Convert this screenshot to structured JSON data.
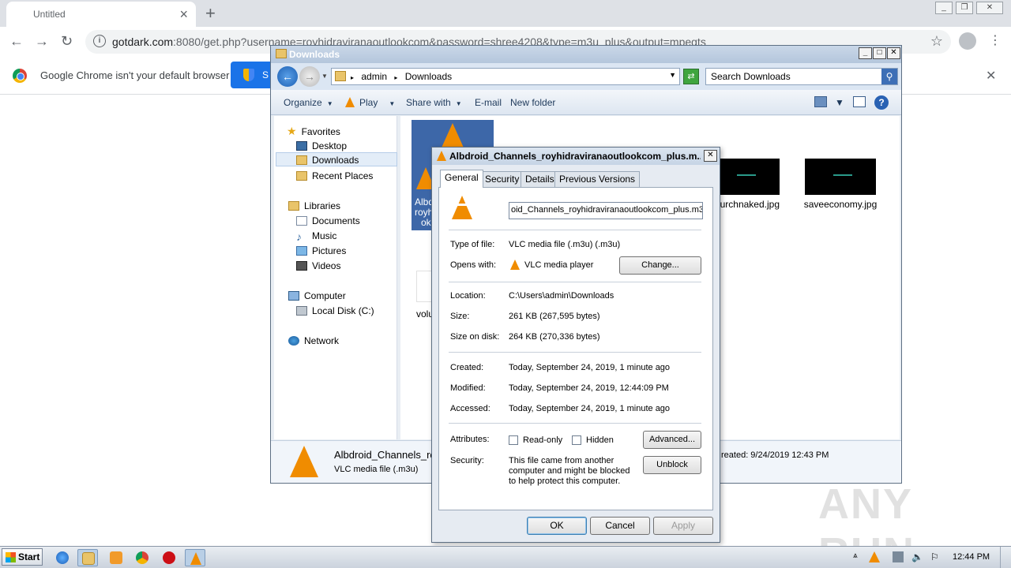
{
  "chrome": {
    "tab_title": "Untitled",
    "tab_close": "×",
    "new_tab": "+",
    "url_host": "gotdark.com",
    "url_rest": ":8080/get.php?username=royhidraviranaoutlookcom&password=shree4208&type=m3u_plus&output=mpegts",
    "infobar_text": "Google Chrome isn't your default browser",
    "infobar_button": "S",
    "infobar_close": "✕"
  },
  "explorer": {
    "title": "Downloads",
    "breadcrumbs": [
      "admin",
      "Downloads"
    ],
    "search_placeholder": "Search Downloads",
    "toolbar": {
      "organize": "Organize",
      "play": "Play",
      "share_with": "Share with",
      "email": "E-mail",
      "new_folder": "New folder"
    },
    "nav": {
      "favorites": "Favorites",
      "desktop": "Desktop",
      "downloads": "Downloads",
      "recent_places": "Recent Places",
      "libraries": "Libraries",
      "documents": "Documents",
      "music": "Music",
      "pictures": "Pictures",
      "videos": "Videos",
      "computer": "Computer",
      "local_disk": "Local Disk (C:)",
      "network": "Network"
    },
    "files": {
      "selected_file_lines": [
        "Albd",
        "royh",
        "ok"
      ],
      "church_label": "urchnaked.jpg",
      "save_label": "saveeconomy.jpg",
      "vol_label": "volu"
    },
    "details": {
      "name": "Albdroid_Channels_roy",
      "type": "VLC media file (.m3u)",
      "created": "reated: 9/24/2019 12:43 PM"
    }
  },
  "properties": {
    "title": "Albdroid_Channels_royhidraviranaoutlookcom_plus.m...",
    "tabs": [
      "General",
      "Security",
      "Details",
      "Previous Versions"
    ],
    "filename": "oid_Channels_royhidraviranaoutlookcom_plus.m3u",
    "type_label": "Type of file:",
    "type_value": "VLC media file (.m3u) (.m3u)",
    "opens_label": "Opens with:",
    "opens_value": "VLC media player",
    "change_btn": "Change...",
    "location_label": "Location:",
    "location_value": "C:\\Users\\admin\\Downloads",
    "size_label": "Size:",
    "size_value": "261 KB (267,595 bytes)",
    "size_disk_label": "Size on disk:",
    "size_disk_value": "264 KB (270,336 bytes)",
    "created_label": "Created:",
    "created_value": "Today, September 24, 2019, 1 minute ago",
    "modified_label": "Modified:",
    "modified_value": "Today, September 24, 2019, 12:44:09 PM",
    "accessed_label": "Accessed:",
    "accessed_value": "Today, September 24, 2019, 1 minute ago",
    "attributes_label": "Attributes:",
    "readonly_label": "Read-only",
    "hidden_label": "Hidden",
    "advanced_btn": "Advanced...",
    "security_label": "Security:",
    "security_text": "This file came from another computer and might be blocked to help protect this computer.",
    "unblock_btn": "Unblock",
    "ok_btn": "OK",
    "cancel_btn": "Cancel",
    "apply_btn": "Apply"
  },
  "watermark": "ANY RUN",
  "taskbar": {
    "start": "Start",
    "clock": "12:44 PM"
  }
}
